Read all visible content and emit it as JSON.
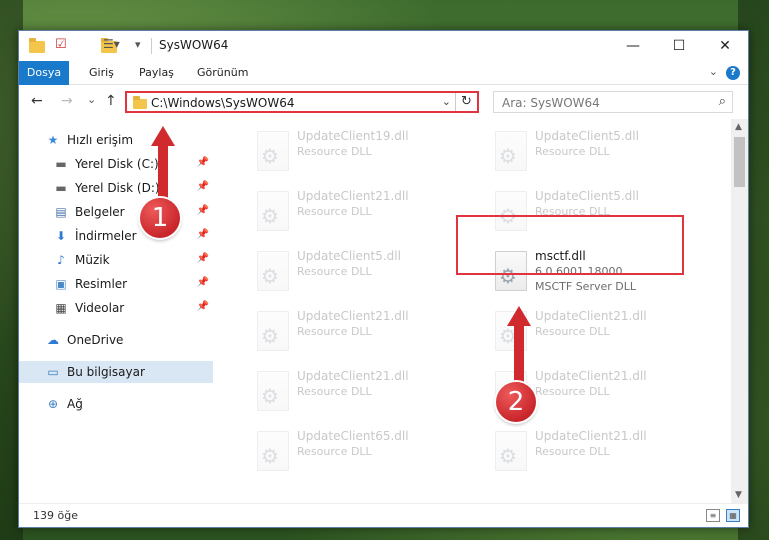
{
  "window": {
    "title": "SysWOW64",
    "minimize_glyph": "—",
    "maximize_glyph": "☐",
    "close_glyph": "✕"
  },
  "ribbon": {
    "tabs": [
      "Dosya",
      "Giriş",
      "Paylaş",
      "Görünüm"
    ],
    "help_glyph": "?"
  },
  "nav": {
    "back_glyph": "←",
    "forward_glyph": "→",
    "recent_glyph": "⌄",
    "up_glyph": "↑",
    "address_path": "C:\\Windows\\SysWOW64",
    "search_placeholder": "Ara: SysWOW64"
  },
  "sidebar": {
    "items": [
      {
        "label": "Hızlı erişim",
        "icon": "star-icon"
      },
      {
        "label": "Yerel Disk (C:)",
        "icon": "drive-icon",
        "pinned": true
      },
      {
        "label": "Yerel Disk (D:)",
        "icon": "drive-icon",
        "pinned": true
      },
      {
        "label": "Belgeler",
        "icon": "documents-icon",
        "pinned": true
      },
      {
        "label": "İndirmeler",
        "icon": "download-icon",
        "pinned": true
      },
      {
        "label": "Müzik",
        "icon": "music-icon",
        "pinned": true
      },
      {
        "label": "Resimler",
        "icon": "pictures-icon",
        "pinned": true
      },
      {
        "label": "Videolar",
        "icon": "video-icon",
        "pinned": true
      },
      {
        "label": "OneDrive",
        "icon": "cloud-icon"
      },
      {
        "label": "Bu bilgisayar",
        "icon": "computer-icon",
        "selected": true
      },
      {
        "label": "Ağ",
        "icon": "network-icon"
      }
    ]
  },
  "files": [
    {
      "name": "UpdateClient19.dll",
      "sub1": "Resource DLL",
      "sub2": ""
    },
    {
      "name": "UpdateClient5.dll",
      "sub1": "Resource DLL",
      "sub2": ""
    },
    {
      "name": "UpdateClient21.dll",
      "sub1": "Resource DLL",
      "sub2": ""
    },
    {
      "name": "UpdateClient5.dll",
      "sub1": "Resource DLL",
      "sub2": ""
    },
    {
      "name": "UpdateClient5.dll",
      "sub1": "Resource DLL",
      "sub2": ""
    },
    {
      "name": "msctf.dll",
      "sub1": "6.0.6001.18000",
      "sub2": "MSCTF Server DLL",
      "highlighted": true
    },
    {
      "name": "UpdateClient21.dll",
      "sub1": "Resource DLL",
      "sub2": ""
    },
    {
      "name": "UpdateClient21.dll",
      "sub1": "Resource DLL",
      "sub2": ""
    },
    {
      "name": "UpdateClient21.dll",
      "sub1": "Resource DLL",
      "sub2": ""
    },
    {
      "name": "UpdateClient21.dll",
      "sub1": "Resource DLL",
      "sub2": ""
    },
    {
      "name": "UpdateClient65.dll",
      "sub1": "Resource DLL",
      "sub2": ""
    },
    {
      "name": "UpdateClient21.dll",
      "sub1": "Resource DLL",
      "sub2": ""
    }
  ],
  "status": {
    "item_count": "139 öğe"
  },
  "annotations": {
    "marker1": "1",
    "marker2": "2",
    "color": "#d0292e"
  }
}
